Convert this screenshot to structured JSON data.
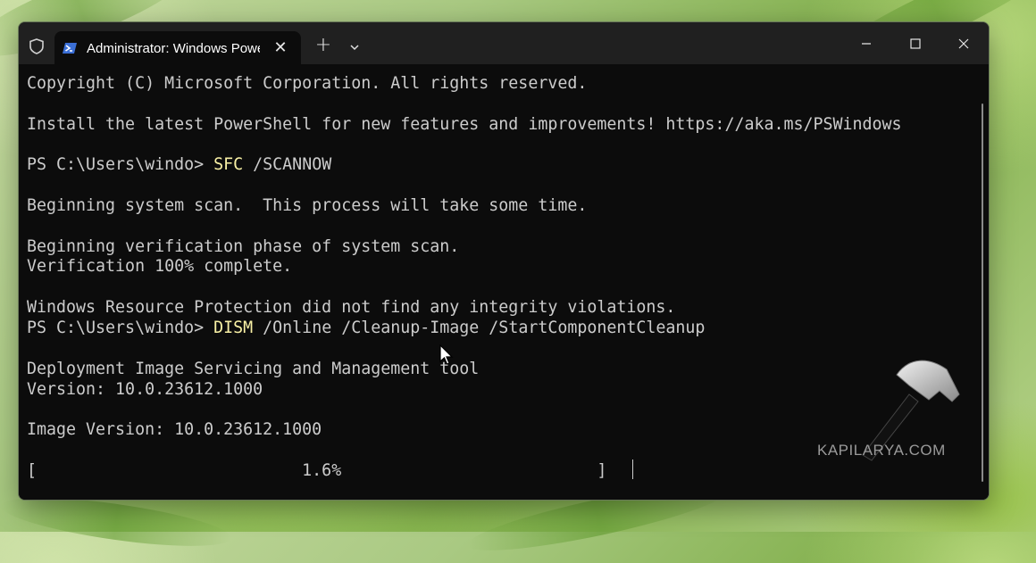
{
  "window": {
    "tab_title": "Administrator: Windows PowerShell",
    "tab_close_symbol": "✕",
    "new_tab_symbol": "+",
    "icons": [
      "shield-icon",
      "powershell-icon",
      "close-icon",
      "plus-icon",
      "chevron-down-icon",
      "minimize-icon",
      "maximize-icon",
      "close-window-icon"
    ]
  },
  "terminal": {
    "line_copyright": "Copyright (C) Microsoft Corporation. All rights reserved.",
    "line_install": "Install the latest PowerShell for new features and improvements! https://aka.ms/PSWindows",
    "prompt1": "PS C:\\Users\\windo> ",
    "cmd1": "SFC",
    "args1": " /SCANNOW",
    "line_begin_scan": "Beginning system scan.  This process will take some time.",
    "line_begin_verify": "Beginning verification phase of system scan.",
    "line_verify_complete": "Verification 100% complete.",
    "line_wrp": "Windows Resource Protection did not find any integrity violations.",
    "prompt2": "PS C:\\Users\\windo> ",
    "cmd2": "DISM",
    "args2": " /Online /Cleanup-Image /StartComponentCleanup",
    "line_dism_tool": "Deployment Image Servicing and Management tool",
    "line_version": "Version: 10.0.23612.1000",
    "line_image_version": "Image Version: 10.0.23612.1000",
    "progress_line": "[                           1.6%                          ]",
    "progress_percent": 1.6
  },
  "watermark": {
    "text": "KAPILARYA.COM"
  },
  "colors": {
    "terminal_bg": "#0c0c0c",
    "titlebar_bg": "#202020",
    "text": "#cccccc",
    "command": "#f9f1a5"
  }
}
